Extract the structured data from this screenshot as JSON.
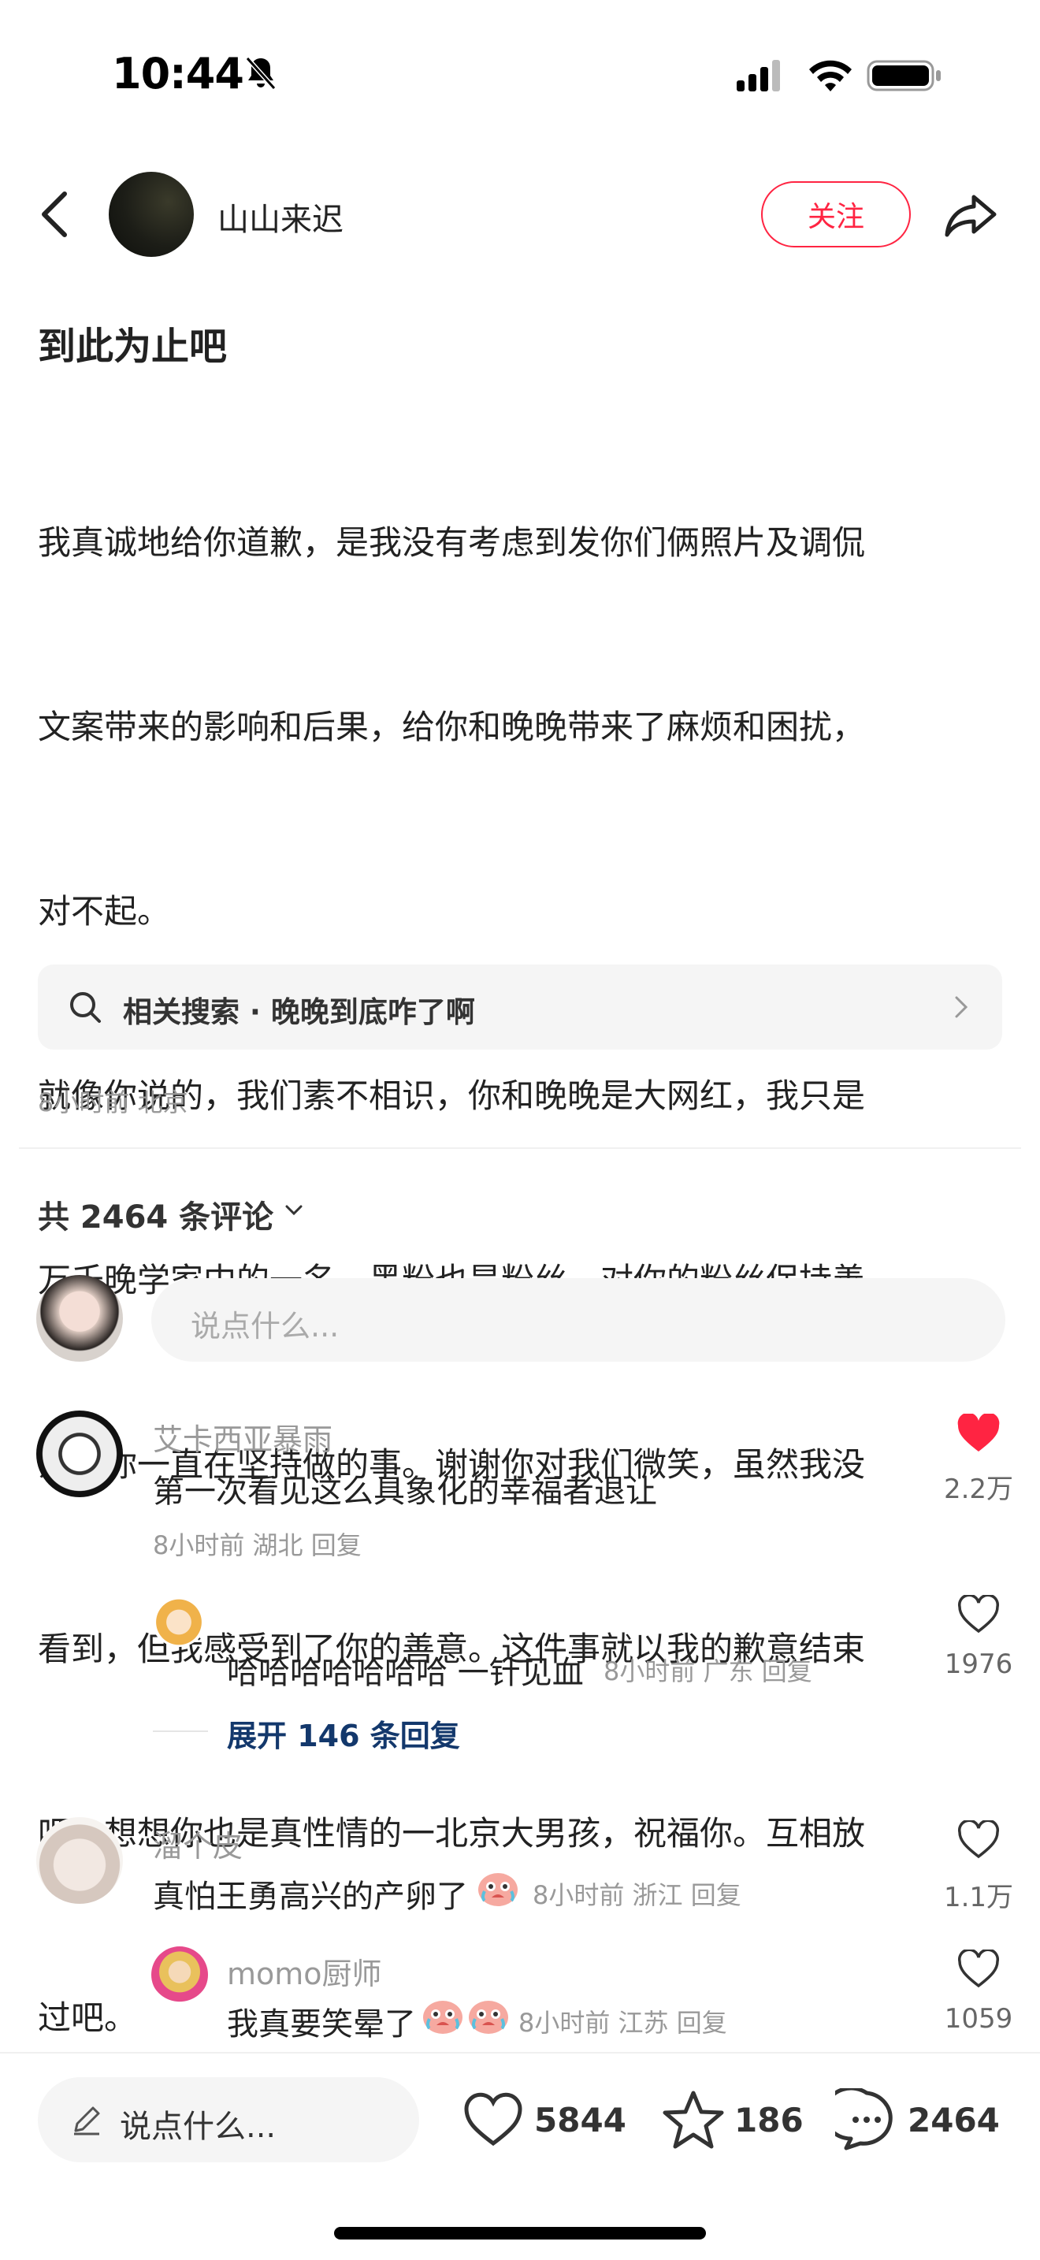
{
  "status_bar": {
    "time": "10:44"
  },
  "header": {
    "username": "山山来迟",
    "follow_label": "关注"
  },
  "post": {
    "title": "到此为止吧",
    "lines": [
      "我真诚地给你道歉，是我没有考虑到发你们俩照片及调侃",
      "文案带来的影响和后果，给你和晚晚带来了麻烦和困扰，",
      "对不起。",
      "就像你说的，我们素不相识，你和晚晚是大网红，我只是",
      "万千晚学家中的一名，黑粉也是粉丝，对你的粉丝保持善",
      "意是你一直在坚持做的事。谢谢你对我们微笑，虽然我没",
      "看到，但我感受到了你的善意。这件事就以我的歉意结束",
      "吧。想想你也是真性情的一北京大男孩，祝福你。互相放",
      "过吧。"
    ],
    "related_search": "相关搜索 · 晚晚到底咋了啊",
    "meta": "8小时前 北京"
  },
  "comments_section": {
    "count_label": "共 2464 条评论",
    "input_placeholder": "说点什么..."
  },
  "comments": [
    {
      "name": "艾卡西亚暴雨",
      "text": "第一次看见这么具象化的幸福者退让",
      "meta": "8小时前 湖北 回复",
      "likes": "2.2万",
      "liked": true,
      "replies": [
        {
          "text": "哈哈哈哈哈哈哈 一针见血",
          "meta": "8小时前 广东 回复",
          "likes": "1976"
        }
      ],
      "expand_label": "展开 146 条回复"
    },
    {
      "name": "溜个皮",
      "text": "真怕王勇高兴的产卵了",
      "meta": "8小时前 浙江 回复",
      "likes": "1.1万",
      "liked": false,
      "replies": [
        {
          "name": "momo厨师",
          "text": "我真要笑晕了",
          "meta": "8小时前 江苏 回复",
          "likes": "1059"
        }
      ]
    }
  ],
  "bottom_bar": {
    "input_placeholder": "说点什么...",
    "likes": "5844",
    "stars": "186",
    "comments": "2464"
  },
  "colors": {
    "accent": "#ff2442",
    "link": "#13386c"
  }
}
